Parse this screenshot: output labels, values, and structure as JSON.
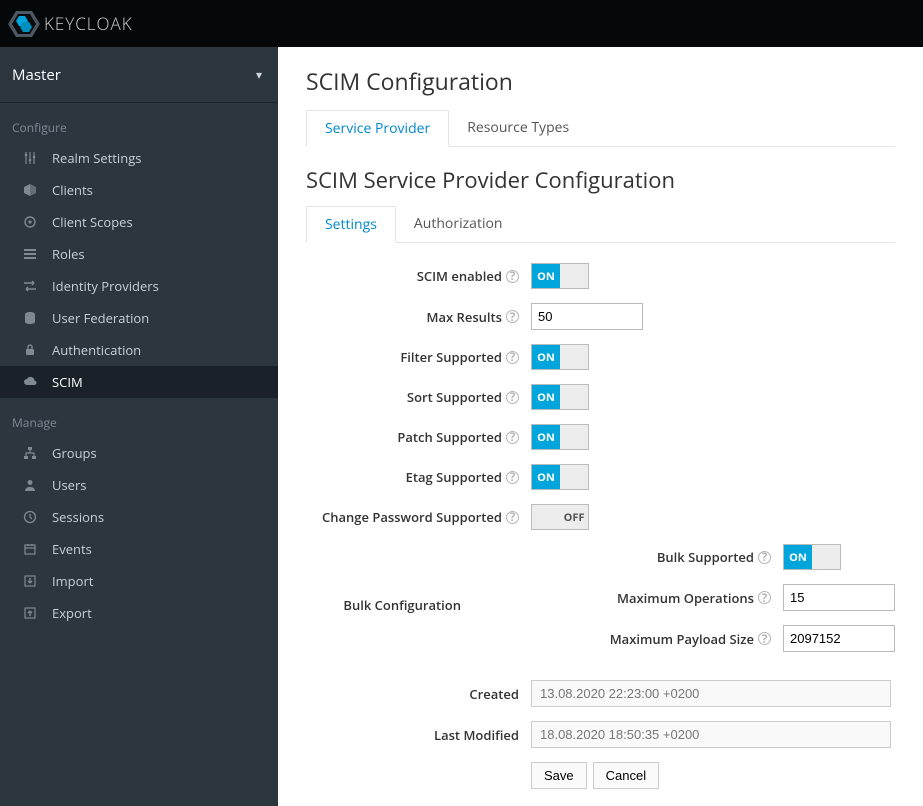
{
  "brand": "KEYCLOAK",
  "realm_selector": {
    "label": "Master"
  },
  "sidebar": {
    "configure_head": "Configure",
    "manage_head": "Manage",
    "configure": [
      {
        "label": "Realm Settings",
        "icon": "sliders"
      },
      {
        "label": "Clients",
        "icon": "cube"
      },
      {
        "label": "Client Scopes",
        "icon": "scope"
      },
      {
        "label": "Roles",
        "icon": "list"
      },
      {
        "label": "Identity Providers",
        "icon": "exchange"
      },
      {
        "label": "User Federation",
        "icon": "database"
      },
      {
        "label": "Authentication",
        "icon": "lock"
      },
      {
        "label": "SCIM",
        "icon": "cloud"
      }
    ],
    "manage": [
      {
        "label": "Groups",
        "icon": "sitemap"
      },
      {
        "label": "Users",
        "icon": "user"
      },
      {
        "label": "Sessions",
        "icon": "clock"
      },
      {
        "label": "Events",
        "icon": "calendar"
      },
      {
        "label": "Import",
        "icon": "import"
      },
      {
        "label": "Export",
        "icon": "export"
      }
    ],
    "active": "SCIM"
  },
  "page": {
    "title": "SCIM Configuration",
    "tabs": [
      "Service Provider",
      "Resource Types"
    ],
    "active_tab": "Service Provider",
    "section_title": "SCIM Service Provider Configuration",
    "subtabs": [
      "Settings",
      "Authorization"
    ],
    "active_subtab": "Settings"
  },
  "form": {
    "scim_enabled": {
      "label": "SCIM enabled",
      "value": true
    },
    "max_results": {
      "label": "Max Results",
      "value": "50"
    },
    "filter_supported": {
      "label": "Filter Supported",
      "value": true
    },
    "sort_supported": {
      "label": "Sort Supported",
      "value": true
    },
    "patch_supported": {
      "label": "Patch Supported",
      "value": true
    },
    "etag_supported": {
      "label": "Etag Supported",
      "value": true
    },
    "change_password_supported": {
      "label": "Change Password Supported",
      "value": false
    },
    "bulk": {
      "heading": "Bulk Configuration",
      "bulk_supported": {
        "label": "Bulk Supported",
        "value": true
      },
      "max_operations": {
        "label": "Maximum Operations",
        "value": "15"
      },
      "max_payload": {
        "label": "Maximum Payload Size",
        "value": "2097152"
      }
    },
    "created": {
      "label": "Created",
      "value": "13.08.2020 22:23:00 +0200"
    },
    "last_modified": {
      "label": "Last Modified",
      "value": "18.08.2020 18:50:35 +0200"
    },
    "buttons": {
      "save": "Save",
      "cancel": "Cancel"
    },
    "toggle_labels": {
      "on": "ON",
      "off": "OFF"
    }
  }
}
